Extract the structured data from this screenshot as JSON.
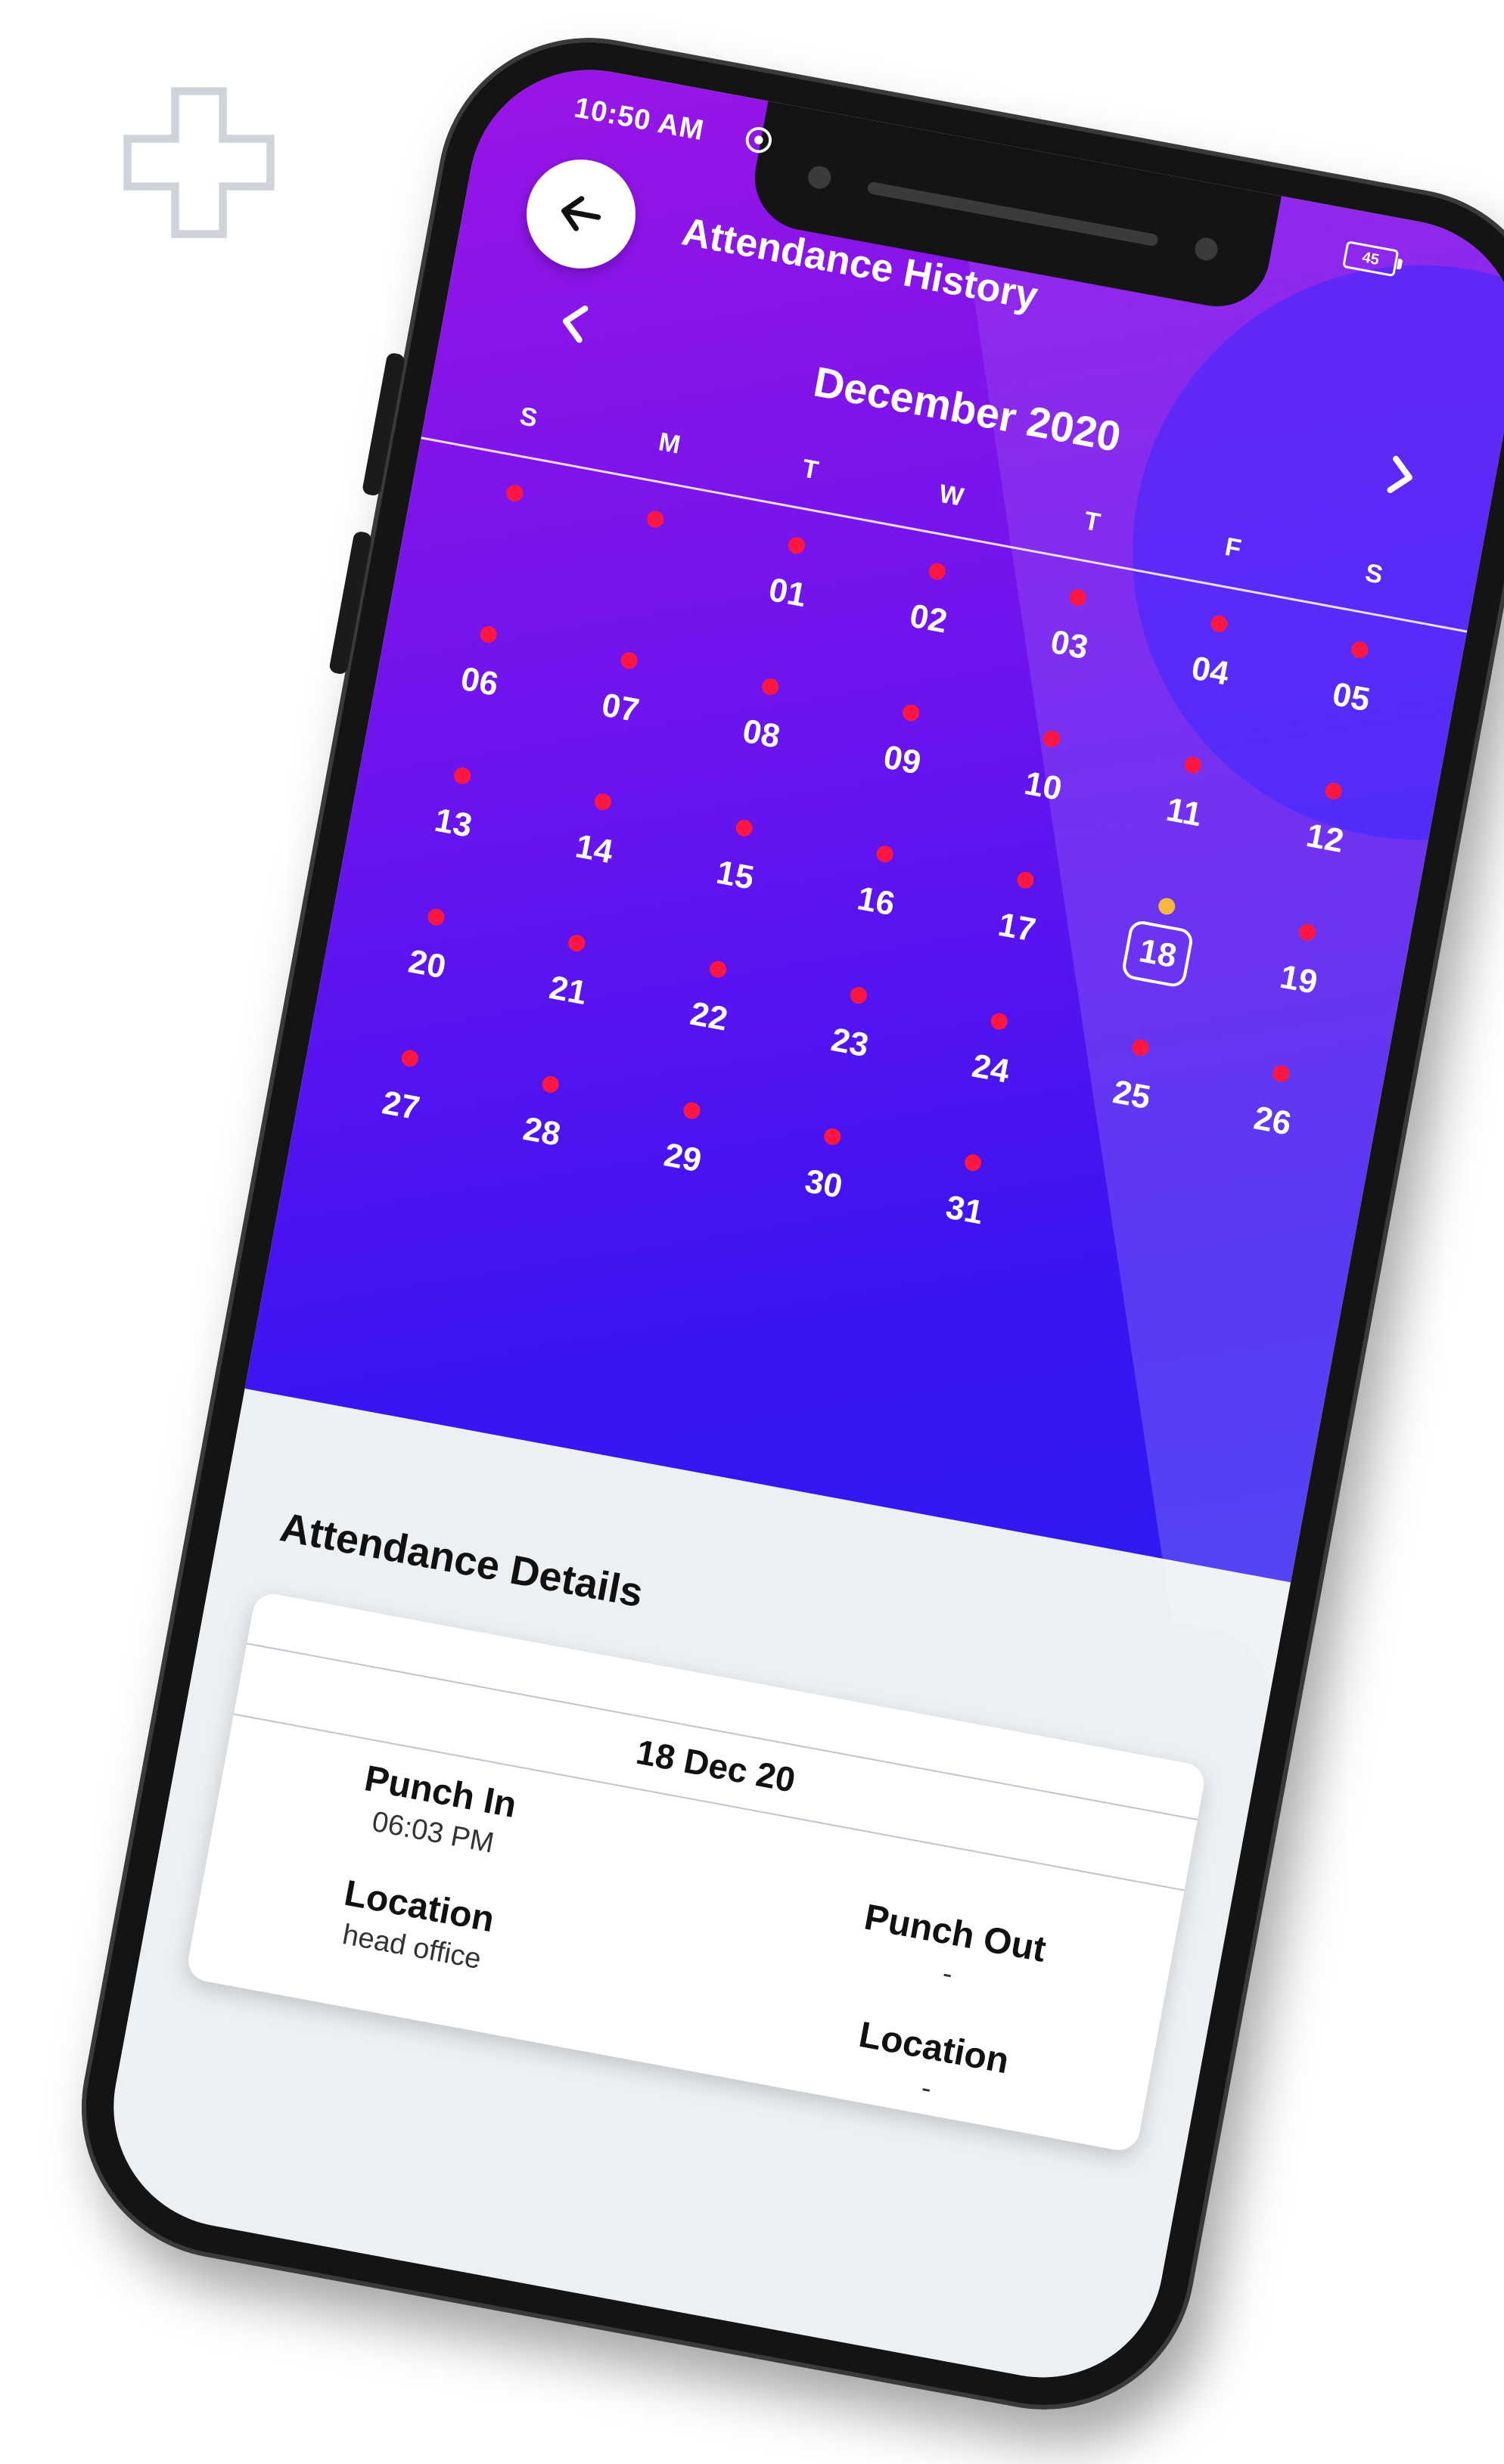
{
  "status_bar": {
    "time": "10:50 AM",
    "battery": "45"
  },
  "header": {
    "title": "Attendance History"
  },
  "calendar": {
    "month_label": "December 2020",
    "weekdays": [
      "S",
      "M",
      "T",
      "W",
      "T",
      "F",
      "S"
    ],
    "selected_day": "18",
    "colors": {
      "absent_dot": "#ff1744",
      "today_dot": "#f6b93b"
    },
    "weeks": [
      [
        "",
        "",
        "01",
        "02",
        "03",
        "04",
        "05"
      ],
      [
        "06",
        "07",
        "08",
        "09",
        "10",
        "11",
        "12"
      ],
      [
        "13",
        "14",
        "15",
        "16",
        "17",
        "18",
        "19"
      ],
      [
        "20",
        "21",
        "22",
        "23",
        "24",
        "25",
        "26"
      ],
      [
        "27",
        "28",
        "29",
        "30",
        "31",
        "",
        ""
      ]
    ]
  },
  "details": {
    "title": "Attendance Details",
    "date": "18 Dec 20",
    "punch_in_label": "Punch In",
    "punch_in_time": "06:03 PM",
    "punch_in_location_label": "Location",
    "punch_in_location": "head office",
    "punch_out_label": "Punch Out",
    "punch_out_time": "-",
    "punch_out_location_label": "Location",
    "punch_out_location": "-"
  }
}
